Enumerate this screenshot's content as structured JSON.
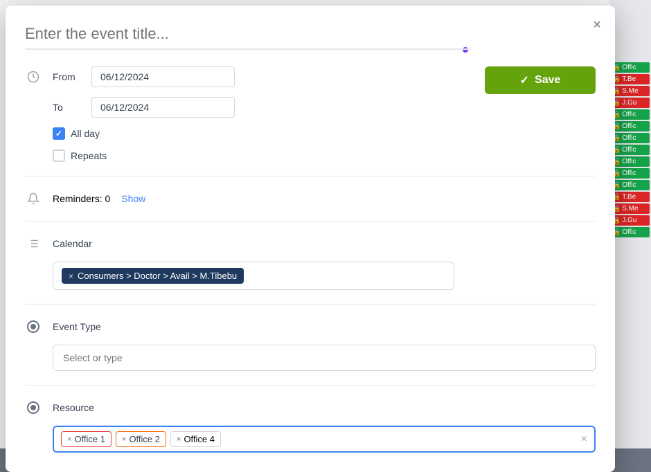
{
  "modal": {
    "title_placeholder": "Enter the event title...",
    "close_label": "×",
    "save_label": "Save",
    "save_check": "✓"
  },
  "form": {
    "from_label": "From",
    "to_label": "To",
    "from_date": "06/12/2024",
    "to_date": "06/12/2024",
    "all_day_label": "All day",
    "repeats_label": "Repeats",
    "reminders_label": "Reminders: 0",
    "reminders_show": "Show",
    "calendar_label": "Calendar",
    "calendar_tag_text": "Consumers > Doctor > Avail > M.Tibebu",
    "event_type_label": "Event Type",
    "event_type_placeholder": "Select or type",
    "resource_label": "Resource",
    "resource_tag1": "Office 1",
    "resource_tag2": "Office 2",
    "resource_tag3": "Office 4",
    "resource_input_value": ""
  },
  "calendar_events": [
    {
      "label": "Offic",
      "color": "green"
    },
    {
      "label": "T.Be",
      "color": "red"
    },
    {
      "label": "S.Me",
      "color": "red"
    },
    {
      "label": "J.Gu",
      "color": "red"
    },
    {
      "label": "Offic",
      "color": "green"
    },
    {
      "label": "Offic",
      "color": "green"
    },
    {
      "label": "Offic",
      "color": "green"
    },
    {
      "label": "Offic",
      "color": "green"
    },
    {
      "label": "Offic",
      "color": "green"
    },
    {
      "label": "Offic",
      "color": "green"
    },
    {
      "label": "Offic",
      "color": "green"
    },
    {
      "label": "T.Be",
      "color": "red"
    },
    {
      "label": "S.Me",
      "color": "red"
    },
    {
      "label": "J.Gu",
      "color": "red"
    },
    {
      "label": "Offic",
      "color": "green"
    }
  ]
}
